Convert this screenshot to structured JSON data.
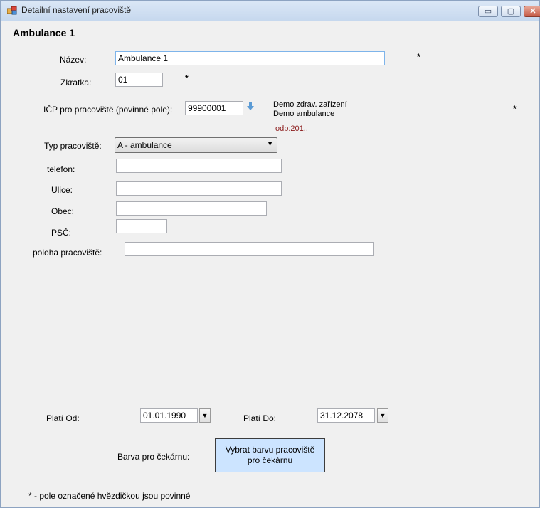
{
  "window": {
    "title": "Detailní nastavení pracoviště",
    "buttons": {
      "minimize": "▭",
      "maximize": "▢",
      "close": "✕"
    }
  },
  "heading": "Ambulance 1",
  "fields": {
    "nazev": {
      "label": "Název:",
      "value": "Ambulance 1"
    },
    "zkratka": {
      "label": "Zkratka:",
      "value": "01"
    },
    "icp": {
      "label": "IČP pro pracoviště (povinné pole):",
      "value": "99900001"
    },
    "typ": {
      "label": "Typ pracoviště:",
      "value": "A - ambulance"
    },
    "telefon": {
      "label": "telefon:",
      "value": ""
    },
    "ulice": {
      "label": "Ulice:",
      "value": ""
    },
    "obec": {
      "label": "Obec:",
      "value": ""
    },
    "psc": {
      "label": "PSČ:",
      "value": ""
    },
    "poloha": {
      "label": "poloha pracoviště:",
      "value": ""
    }
  },
  "icp_info": {
    "line1": "Demo zdrav. zařízení",
    "line2": "Demo ambulance",
    "odb": "odb:201,,"
  },
  "required_marker": "*",
  "validity": {
    "from_label": "Platí Od:",
    "from_value": "01.01.1990",
    "to_label": "Platí Do:",
    "to_value": "31.12.2078"
  },
  "color": {
    "label": "Barva pro čekárnu:",
    "button_label": "Vybrat barvu pracoviště pro čekárnu"
  },
  "footer_note": "* - pole označené hvězdičkou jsou povinné",
  "icons": {
    "dropdown": "▼",
    "lookup": "arrow-down-icon"
  }
}
